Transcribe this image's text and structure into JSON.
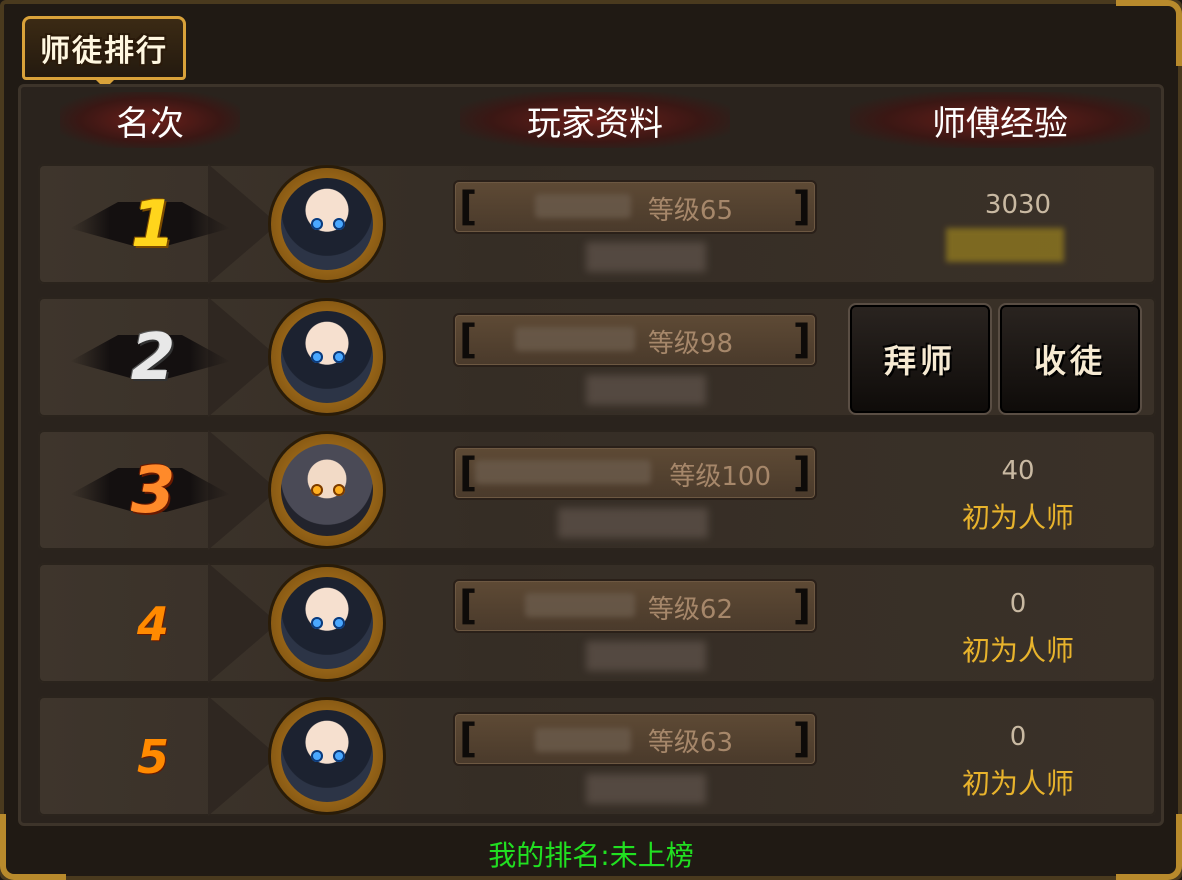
{
  "title": "师徒排行",
  "headers": {
    "rank": "名次",
    "player_info": "玩家资料",
    "master_exp": "师傅经验"
  },
  "rows": [
    {
      "rank": "1",
      "level": "等级65",
      "exp": "3030",
      "title": "",
      "avatar": "boy"
    },
    {
      "rank": "2",
      "level": "等级98",
      "exp": "",
      "title": "",
      "avatar": "boy",
      "buttons": [
        "拜师",
        "收徒"
      ]
    },
    {
      "rank": "3",
      "level": "等级100",
      "exp": "40",
      "title": "初为人师",
      "avatar": "warrior"
    },
    {
      "rank": "4",
      "level": "等级62",
      "exp": "0",
      "title": "初为人师",
      "avatar": "boy"
    },
    {
      "rank": "5",
      "level": "等级63",
      "exp": "0",
      "title": "初为人师",
      "avatar": "boy"
    }
  ],
  "my_rank": "我的排名:未上榜",
  "colors": {
    "footer_text": "#21e021",
    "gold": "#e8b32c",
    "accent": "#d9a23a"
  }
}
